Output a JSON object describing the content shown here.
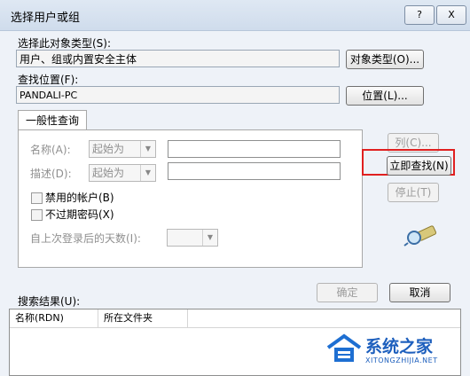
{
  "window": {
    "title": "选择用户或组",
    "help_btn": "?",
    "close_btn": "X"
  },
  "object_type": {
    "label": "选择此对象类型(S):",
    "value": "用户、组或内置安全主体",
    "button": "对象类型(O)..."
  },
  "location": {
    "label": "查找位置(F):",
    "value": "PANDALI-PC",
    "button": "位置(L)..."
  },
  "tab": {
    "label": "一般性查询"
  },
  "query": {
    "name_label": "名称(A):",
    "name_mode": "起始为",
    "desc_label": "描述(D):",
    "desc_mode": "起始为",
    "disabled_accounts": "禁用的帐户(B)",
    "nonexpiring_pw": "不过期密码(X)",
    "days_since_logon": "自上次登录后的天数(I):"
  },
  "buttons": {
    "columns": "列(C)...",
    "find_now": "立即查找(N)",
    "stop": "停止(T)",
    "ok": "确定",
    "cancel": "取消"
  },
  "results": {
    "label": "搜索结果(U):",
    "columns": [
      "名称(RDN)",
      "所在文件夹"
    ]
  },
  "watermark": {
    "brand": "系统之家",
    "url": "XITONGZHIJIA.NET"
  }
}
